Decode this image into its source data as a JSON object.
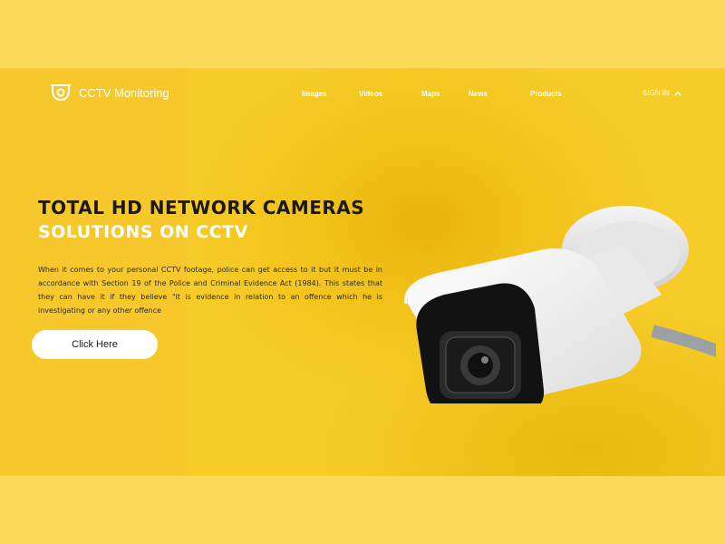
{
  "brand": {
    "name": "CCTV Monitoring",
    "icon": "cctv-camera-icon"
  },
  "nav": {
    "items": [
      {
        "label": "Images"
      },
      {
        "label": "Videos"
      },
      {
        "label": "Maps"
      },
      {
        "label": "News"
      },
      {
        "label": "Products"
      }
    ],
    "signin_label": "SIGN IN",
    "signin_icon": "chevron-up-icon"
  },
  "hero": {
    "title": "TOTAL HD NETWORK CAMERAS",
    "subtitle": "SOLUTIONS ON CCTV",
    "description": "When it comes to your personal CCTV footage, police can get access to it but it must be in accordance with Section 19 of the Police and Criminal Evidence Act (1984). This states that they can have it if they believe \"it is evidence in relation to an offence which he is investigating or any other offence",
    "cta_label": "Click Here",
    "image": "cctv-camera-image"
  },
  "colors": {
    "page_background": "#fdd95a",
    "hero_background": "#f7cc28",
    "accent_text": "#ffffff",
    "heading_text": "#1a1a1a"
  }
}
